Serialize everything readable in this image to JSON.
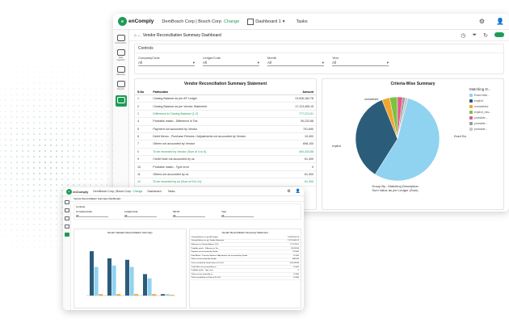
{
  "main": {
    "logo_mark": "e",
    "logo_text": "enComply",
    "org": "DemBosch Corp | Bosch Corp",
    "change": "Change",
    "dashboard": "Dashboard 1",
    "tasks": "Tasks",
    "breadcrumb": "Vendor Reconciliation Summary Dashboard",
    "sidebar": [
      "Connections",
      "Data Ingestion",
      "Dataview",
      "Reports",
      "Dashboards"
    ],
    "controls": {
      "title": "Controls",
      "filters": [
        {
          "label": "CompanyCode",
          "value": "All"
        },
        {
          "label": "LedgerCode",
          "value": "All"
        },
        {
          "label": "Month",
          "value": "All"
        },
        {
          "label": "Year",
          "value": "All"
        }
      ]
    },
    "summary": {
      "title": "Vendor Reconciliation Summary Statement",
      "columns": [
        "S.No",
        "Particulars",
        "Amount"
      ],
      "rows": [
        {
          "no": "1",
          "text": "Closing Balance as per AP Ledger",
          "amount": "13,928,184.78",
          "hl": false
        },
        {
          "no": "2",
          "text": "Closing Balance as per Vendor Statement",
          "amount": "17,113,406.15",
          "hl": false
        },
        {
          "no": "3",
          "text": "Difference in Closing Balance (1-2)",
          "amount": "777,274.51",
          "hl": true
        },
        {
          "no": "4",
          "text": "Probable match - Difference in Tax",
          "amount": "39,233.88",
          "hl": false
        },
        {
          "no": "5",
          "text": "Payment not accounted by Vendor",
          "amount": "701,690",
          "hl": false
        },
        {
          "no": "6",
          "text": "Debit Memo - Purchase Returns / Adjustments not accounted by Vendor",
          "amount": "10,400",
          "hl": false
        },
        {
          "no": "7",
          "text": "Others not accounted by Vendor",
          "amount": "698,100",
          "hl": false
        },
        {
          "no": "8",
          "text": "To be recorded by Vendor (Sum of 4 to 6)",
          "amount": "400,433.88",
          "hl": true
        },
        {
          "no": "9",
          "text": "Credit Note not accounted by us",
          "amount": "61,300",
          "hl": false
        },
        {
          "no": "10",
          "text": "Probable match - Type error",
          "amount": "0",
          "hl": false
        },
        {
          "no": "11",
          "text": "Others not accounted by us",
          "amount": "61,300",
          "hl": false
        },
        {
          "no": "12",
          "text": "To be recorded by us (Sum of 9 to 11)",
          "amount": "61,300",
          "hl": true
        }
      ]
    },
    "criteria": {
      "title": "Criteria-Wise Summary",
      "legend_title": "Matching D...",
      "legend": [
        {
          "label": "Exact Mat...",
          "color": "#8fd3f0"
        },
        {
          "label": "explicit",
          "color": "#2b5c7a"
        },
        {
          "label": "unmatched",
          "color": "#f0a531"
        },
        {
          "label": "explicit_mis...",
          "color": "#7cc242"
        },
        {
          "label": "probable...",
          "color": "#e25b8c"
        },
        {
          "label": "probable...",
          "color": "#9a9a9a"
        },
        {
          "label": "probable...",
          "color": "#c8c8c8"
        }
      ],
      "slice_labels": [
        "Exact Exact Matche...",
        "explicit",
        "unmatched"
      ],
      "caption_1": "Group By : Matching Description",
      "caption_2": "Sum Value as per Ledger (Sum)"
    }
  },
  "second": {
    "logo_text": "enComply",
    "org": "DemBosch Corp | Bosch Corp",
    "change": "Change",
    "dashboard": "Dashboard",
    "tasks": "Tasks",
    "breadcrumb": "Vendor Reconciliation Summary Dashboard",
    "controls_title": "Controls",
    "filters": [
      "CompanyCode",
      "LedgerCode",
      "Month",
      "Year"
    ],
    "filter_value": "All",
    "left_title": "Vendor Valuation Reconciliation Summary",
    "right_title": "Vendor Reconciliation Summary Statement"
  },
  "chart_data": {
    "type": "bar",
    "title": "Vendor Valuation Reconciliation Summary",
    "categories": [
      "C1",
      "C2",
      "C3",
      "C4",
      "C5"
    ],
    "series": [
      {
        "name": "series-1",
        "values": [
          62,
          52,
          50,
          30,
          2
        ]
      },
      {
        "name": "series-2",
        "values": [
          40,
          42,
          40,
          24,
          2
        ]
      },
      {
        "name": "series-3",
        "values": [
          2,
          2,
          2,
          2,
          1
        ]
      }
    ],
    "colors": [
      "#2b5c7a",
      "#8fd3f0",
      "#f0a531"
    ]
  },
  "pie_data": {
    "type": "pie",
    "values": [
      55,
      35,
      3,
      3,
      2,
      1,
      1
    ],
    "colors": [
      "#8fd3f0",
      "#2b5c7a",
      "#f0a531",
      "#7cc242",
      "#e25b8c",
      "#9a9a9a",
      "#c8c8c8"
    ]
  }
}
